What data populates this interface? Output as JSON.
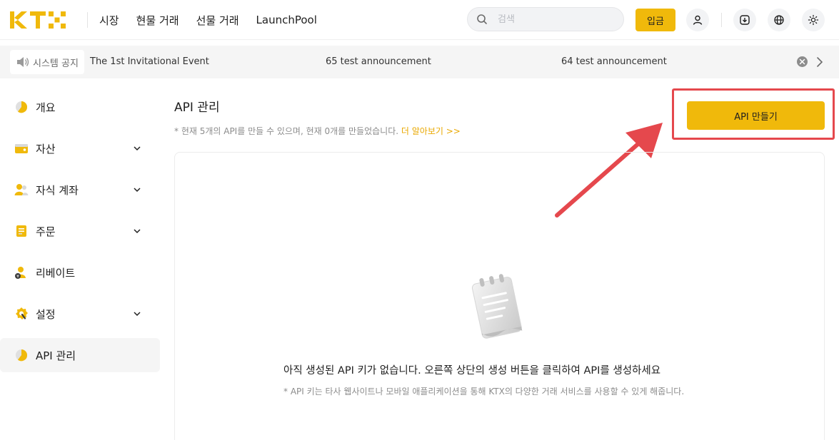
{
  "header": {
    "logo_text": "KTX",
    "nav": [
      "시장",
      "현물 거래",
      "선물 거래",
      "LaunchPool"
    ],
    "search_placeholder": "검색",
    "login_label": "입금",
    "icons": [
      "user-icon",
      "download-icon",
      "globe-icon",
      "sun-icon"
    ]
  },
  "announcements": {
    "label": "시스템 공지",
    "items": [
      "The 1st Invitational Event",
      "65 test announcement",
      "64 test announcement"
    ]
  },
  "sidebar": {
    "items": [
      {
        "label": "개요",
        "icon": "overview-icon",
        "expandable": false
      },
      {
        "label": "자산",
        "icon": "wallet-icon",
        "expandable": true
      },
      {
        "label": "자식 계좌",
        "icon": "sub-account-icon",
        "expandable": true
      },
      {
        "label": "주문",
        "icon": "orders-icon",
        "expandable": true
      },
      {
        "label": "리베이트",
        "icon": "rebate-icon",
        "expandable": false
      },
      {
        "label": "설정",
        "icon": "settings-icon",
        "expandable": true
      },
      {
        "label": "API 관리",
        "icon": "api-icon",
        "expandable": false,
        "active": true
      }
    ]
  },
  "main": {
    "title": "API 관리",
    "note": "* 현재 5개의 API를 만들 수 있으며, 현재 0개를 만들었습니다.",
    "note_link": "더 알아보기 >>",
    "create_label": "API 만들기",
    "empty_title": "아직 생성된 API 키가 없습니다. 오른쪽 상단의 생성 버튼을 클릭하여 API를 생성하세요",
    "empty_sub": "* API 키는 타사 웹사이트나 모바일 애플리케이션을 통해 KTX의 다양한 거래 서비스를 사용할 수 있게 해줍니다."
  },
  "colors": {
    "accent": "#f0b90b",
    "highlight": "#e5484d"
  }
}
